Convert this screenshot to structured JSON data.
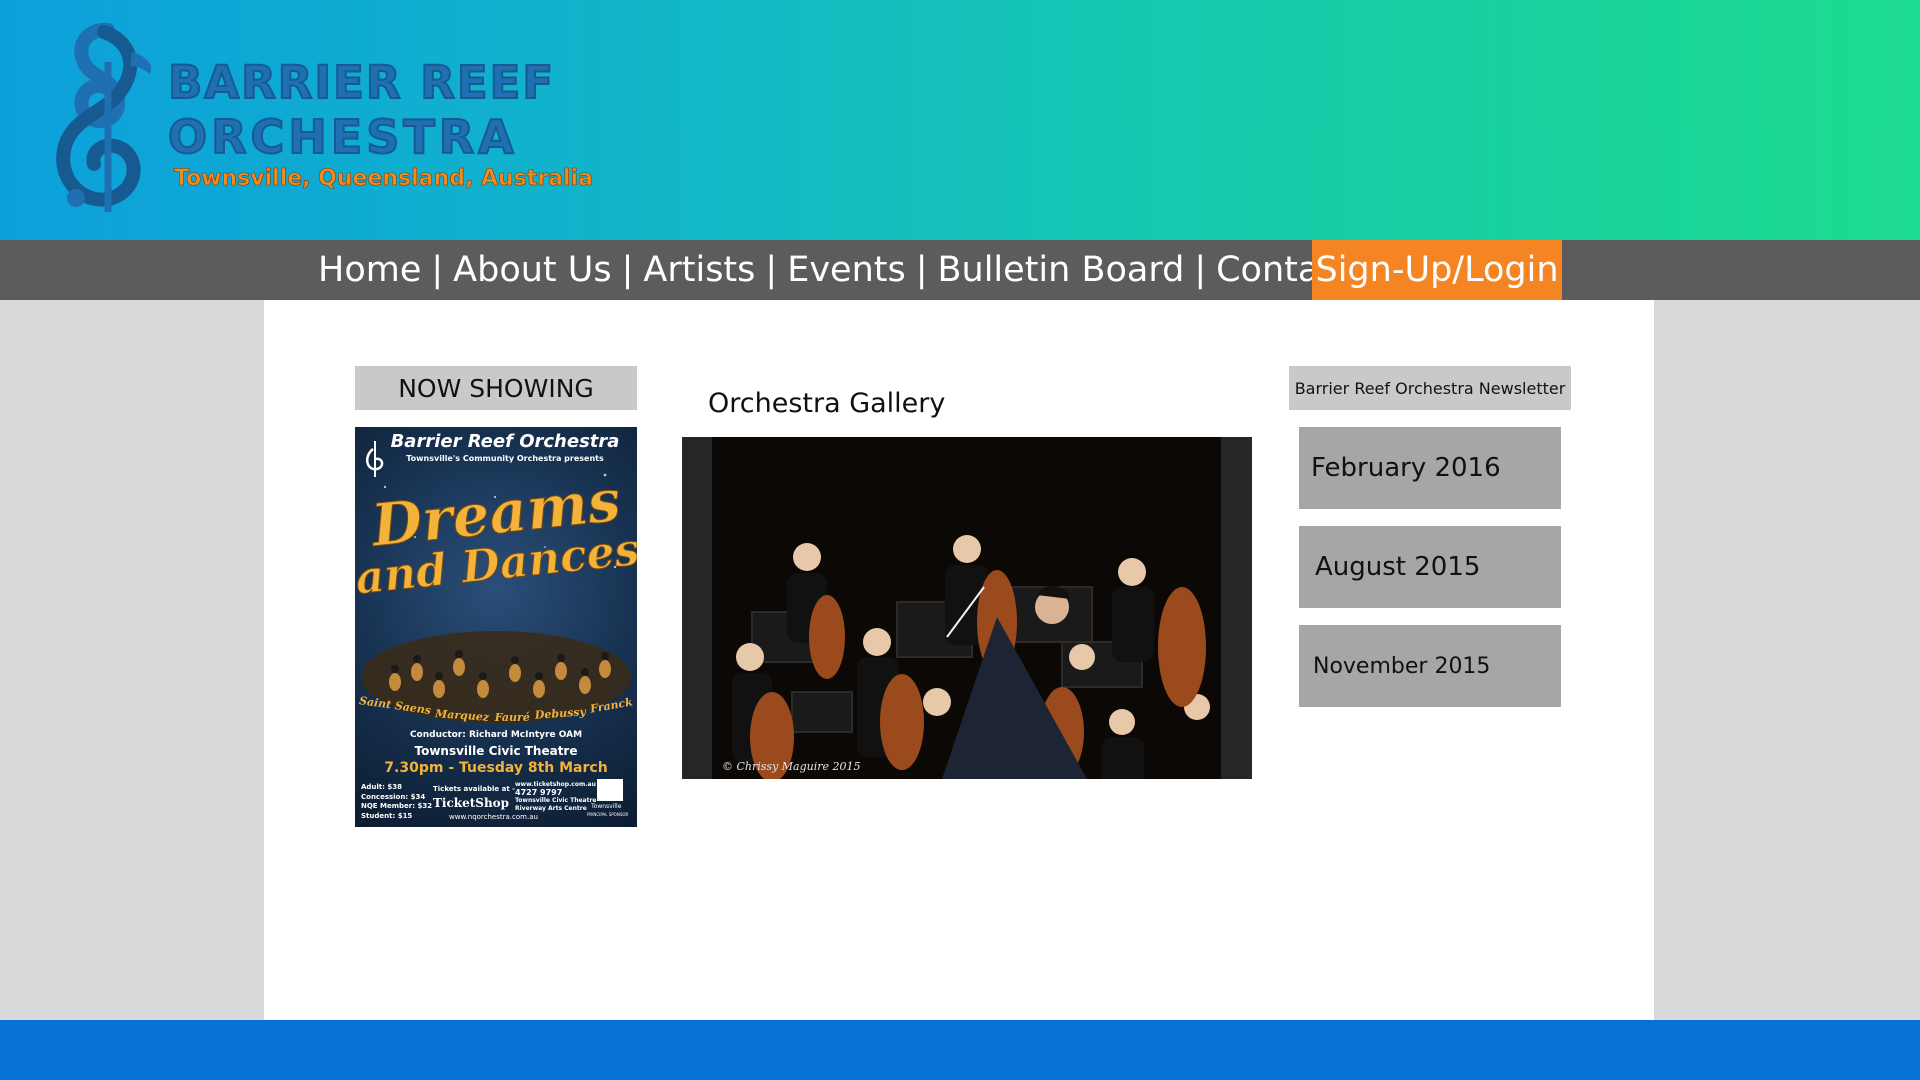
{
  "brand": {
    "line1": "BARRIER REEF",
    "line2": "ORCHESTRA",
    "tagline": "Townsville, Queensland, Australia",
    "logo_icon": "treble-clef-seahorse-icon"
  },
  "nav": {
    "items": [
      {
        "label": "Home"
      },
      {
        "label": "About Us"
      },
      {
        "label": "Artists"
      },
      {
        "label": "Events"
      },
      {
        "label": "Bulletin Board"
      },
      {
        "label": "Contact Us"
      }
    ],
    "separator": "|",
    "signup_label": "Sign-Up/Login"
  },
  "now_showing": {
    "label": "NOW SHOWING",
    "poster": {
      "org": "Barrier Reef Orchestra",
      "subtitle": "Townsville's Community Orchestra presents",
      "title_line1": "Dreams",
      "title_line2": "and Dances",
      "composers": [
        "Saint Saens",
        "Marquez",
        "Fauré",
        "Debussy",
        "Franck"
      ],
      "conductor": "Conductor: Richard McIntyre OAM",
      "venue": "Townsville Civic Theatre",
      "datetime": "7.30pm - Tuesday 8th March",
      "prices": [
        "Adult: $38",
        "Concession: $34",
        "NQE Member: $32",
        "Student: $15"
      ],
      "tickets_label": "Tickets available at -",
      "ticketshop": "TicketShop",
      "ticket_lines": [
        "www.ticketshop.com.au",
        "4727 9797",
        "Townsville Civic Theatre",
        "Riverway Arts Centre"
      ],
      "sponsor": "Townsville",
      "sponsor_note": "PRINCIPAL SPONSOR",
      "website": "www.nqorchestra.com.au"
    }
  },
  "gallery": {
    "title": "Orchestra Gallery",
    "photo_credit": "© Chrissy Maguire 2015"
  },
  "newsletter": {
    "label": "Barrier Reef Orchestra Newsletter",
    "issues": [
      {
        "label": "February 2016"
      },
      {
        "label": "August 2015"
      },
      {
        "label": "November 2015"
      }
    ]
  },
  "colors": {
    "header_start": "#0d9fdc",
    "header_end": "#1ddb8f",
    "nav_bg": "#5c5c5c",
    "signup_bg": "#f58523",
    "footer_bg": "#0871d6",
    "panel_bg": "#c9c9c9",
    "issue_bg": "#a6a6a6"
  }
}
